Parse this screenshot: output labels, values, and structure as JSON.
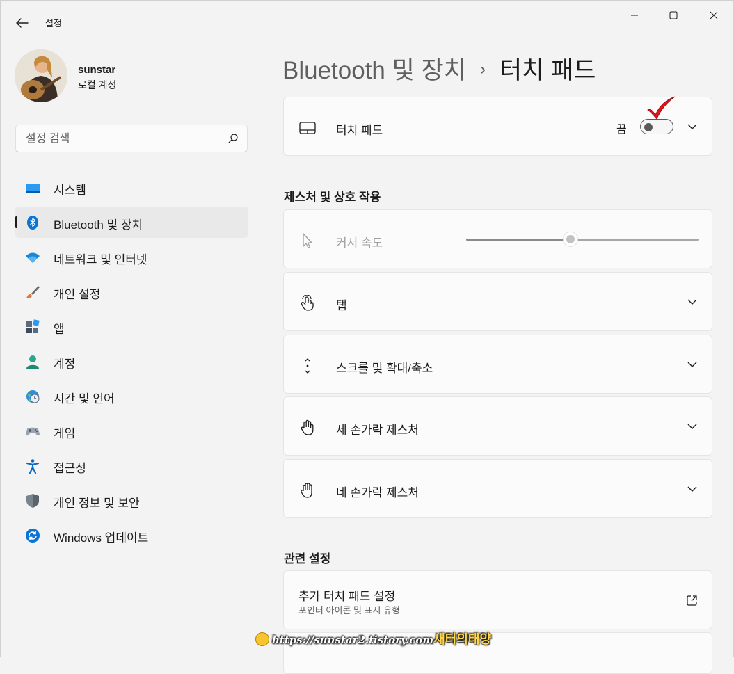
{
  "window": {
    "app_title": "설정"
  },
  "profile": {
    "name": "sunstar",
    "account_type": "로컬 계정"
  },
  "search": {
    "placeholder": "설정 검색"
  },
  "sidebar": {
    "items": [
      {
        "label": "시스템",
        "icon": "system-icon",
        "color": "#0078d4"
      },
      {
        "label": "Bluetooth 및 장치",
        "icon": "bluetooth-icon",
        "color": "#0067c0",
        "active": true
      },
      {
        "label": "네트워크 및 인터넷",
        "icon": "wifi-icon",
        "color": "#1a86d6"
      },
      {
        "label": "개인 설정",
        "icon": "brush-icon",
        "color": "#d86f3c"
      },
      {
        "label": "앱",
        "icon": "apps-icon",
        "color": "#5a6b80"
      },
      {
        "label": "계정",
        "icon": "account-icon",
        "color": "#2ca58d"
      },
      {
        "label": "시간 및 언어",
        "icon": "time-language-icon",
        "color": "#2d8fd6"
      },
      {
        "label": "게임",
        "icon": "gamepad-icon",
        "color": "#8a8a8a"
      },
      {
        "label": "접근성",
        "icon": "accessibility-icon",
        "color": "#0b6bc5"
      },
      {
        "label": "개인 정보 및 보안",
        "icon": "shield-icon",
        "color": "#6d7680"
      },
      {
        "label": "Windows 업데이트",
        "icon": "update-icon",
        "color": "#0a74d4"
      }
    ]
  },
  "breadcrumb": {
    "parent": "Bluetooth 및 장치",
    "separator": "›",
    "current": "터치 패드"
  },
  "touchpad_card": {
    "label": "터치 패드",
    "toggle_state": "끔",
    "toggle_on": false
  },
  "gestures_section": {
    "title": "제스처 및 상호 작용",
    "cursor_speed": {
      "label": "커서 속도",
      "value_fraction": 0.45,
      "disabled": true
    },
    "items": [
      {
        "label": "탭",
        "icon": "tap-icon"
      },
      {
        "label": "스크롤 및 확대/축소",
        "icon": "scroll-icon"
      },
      {
        "label": "세 손가락 제스처",
        "icon": "three-finger-icon"
      },
      {
        "label": "네 손가락 제스처",
        "icon": "four-finger-icon"
      }
    ]
  },
  "related_section": {
    "title": "관련 설정",
    "more_settings": {
      "title": "추가 터치 패드 설정",
      "subtitle": "포인터 아이콘 및 표시 유형"
    }
  },
  "watermark": {
    "url": "https://sunstar2.tistory.com",
    "site_name": "새터의태양"
  },
  "colors": {
    "background": "#f3f3f3",
    "card": "#fbfbfb",
    "accent": "#0067c0",
    "annotation_check": "#e0141e"
  }
}
